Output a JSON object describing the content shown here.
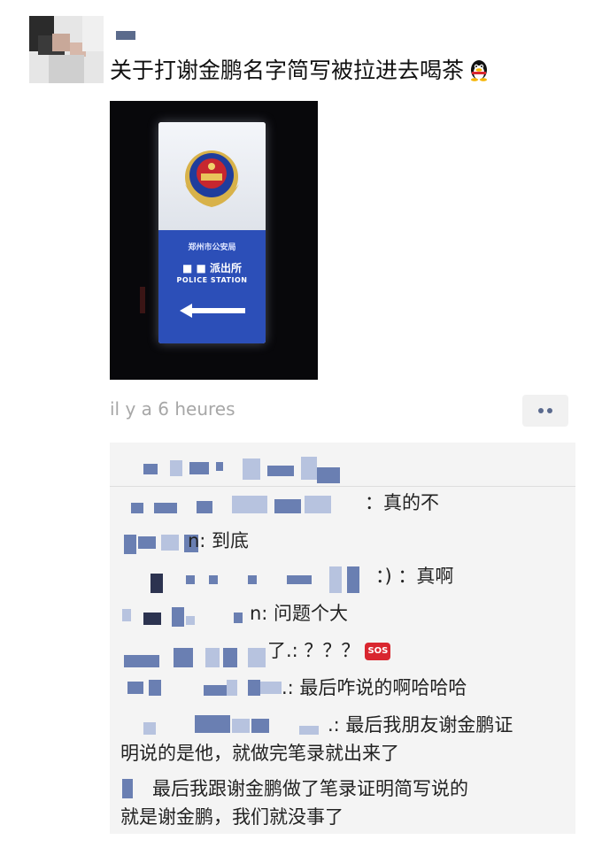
{
  "post": {
    "text": "关于打谢金鹏名字简写被拉进去喝茶",
    "emoji": "qq-penguin-emoji",
    "timestamp": "il y a 6 heures"
  },
  "photo": {
    "city_bureau": "郑州市公安局",
    "station_name": "■ ■ 派出所",
    "station_en": "POLICE STATION"
  },
  "comments": [
    {
      "suffix": "：真的不"
    },
    {
      "suffix": "n: 到底"
    },
    {
      "suffix": "：) ：真啊"
    },
    {
      "suffix": "n: 问题个大"
    },
    {
      "suffix": "了.: ？？？"
    },
    {
      "suffix": ".: 最后咋说的啊哈哈哈"
    },
    {
      "suffix": ".: 最后我朋友谢金鹏证",
      "line2": "明说的是他，就做完笔录就出来了"
    },
    {
      "suffix": "最后我跟谢金鹏做了笔录证明简写说的",
      "line2": "就是谢金鹏，我们就没事了"
    }
  ],
  "sos_label": "SOS",
  "colors": {
    "link_blue": "#5b6b8c",
    "sign_blue": "#2c4fb8",
    "sos_red": "#d9262f"
  }
}
